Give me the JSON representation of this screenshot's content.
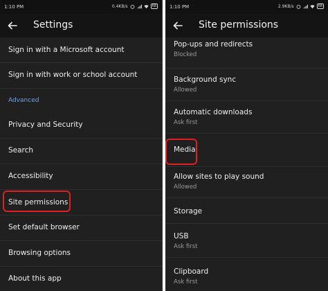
{
  "left": {
    "status": {
      "time": "1:10 PM",
      "speed": "0.4KB/s",
      "battery": "68"
    },
    "title": "Settings",
    "items": [
      {
        "label": "Sign in with a Microsoft account"
      },
      {
        "label": "Sign in with work or school account"
      },
      {
        "header": "Advanced"
      },
      {
        "label": "Privacy and Security"
      },
      {
        "label": "Search"
      },
      {
        "label": "Accessibility"
      },
      {
        "label": "Site permissions"
      },
      {
        "label": "Set default browser"
      },
      {
        "label": "Browsing options"
      },
      {
        "label": "About this app"
      }
    ]
  },
  "right": {
    "status": {
      "time": "1:10 PM",
      "speed": "2.9KB/s",
      "battery": "68"
    },
    "title": "Site permissions",
    "items": [
      {
        "label": "Pop-ups and redirects",
        "sub": "Blocked"
      },
      {
        "label": "Background sync",
        "sub": "Allowed"
      },
      {
        "label": "Automatic downloads",
        "sub": "Ask first"
      },
      {
        "label": "Media"
      },
      {
        "label": "Allow sites to play sound",
        "sub": "Allowed"
      },
      {
        "label": "Storage"
      },
      {
        "label": "USB",
        "sub": "Ask first"
      },
      {
        "label": "Clipboard",
        "sub": "Ask first"
      }
    ]
  },
  "colors": {
    "background": "#202020",
    "appbar": "#141414",
    "accent": "#6fa2e6",
    "highlight": "#e02020"
  },
  "icons": {
    "back": "arrow-left-icon",
    "signal": "signal-icon",
    "wifi": "wifi-icon",
    "alarm": "alarm-icon",
    "battery": "battery-icon"
  }
}
